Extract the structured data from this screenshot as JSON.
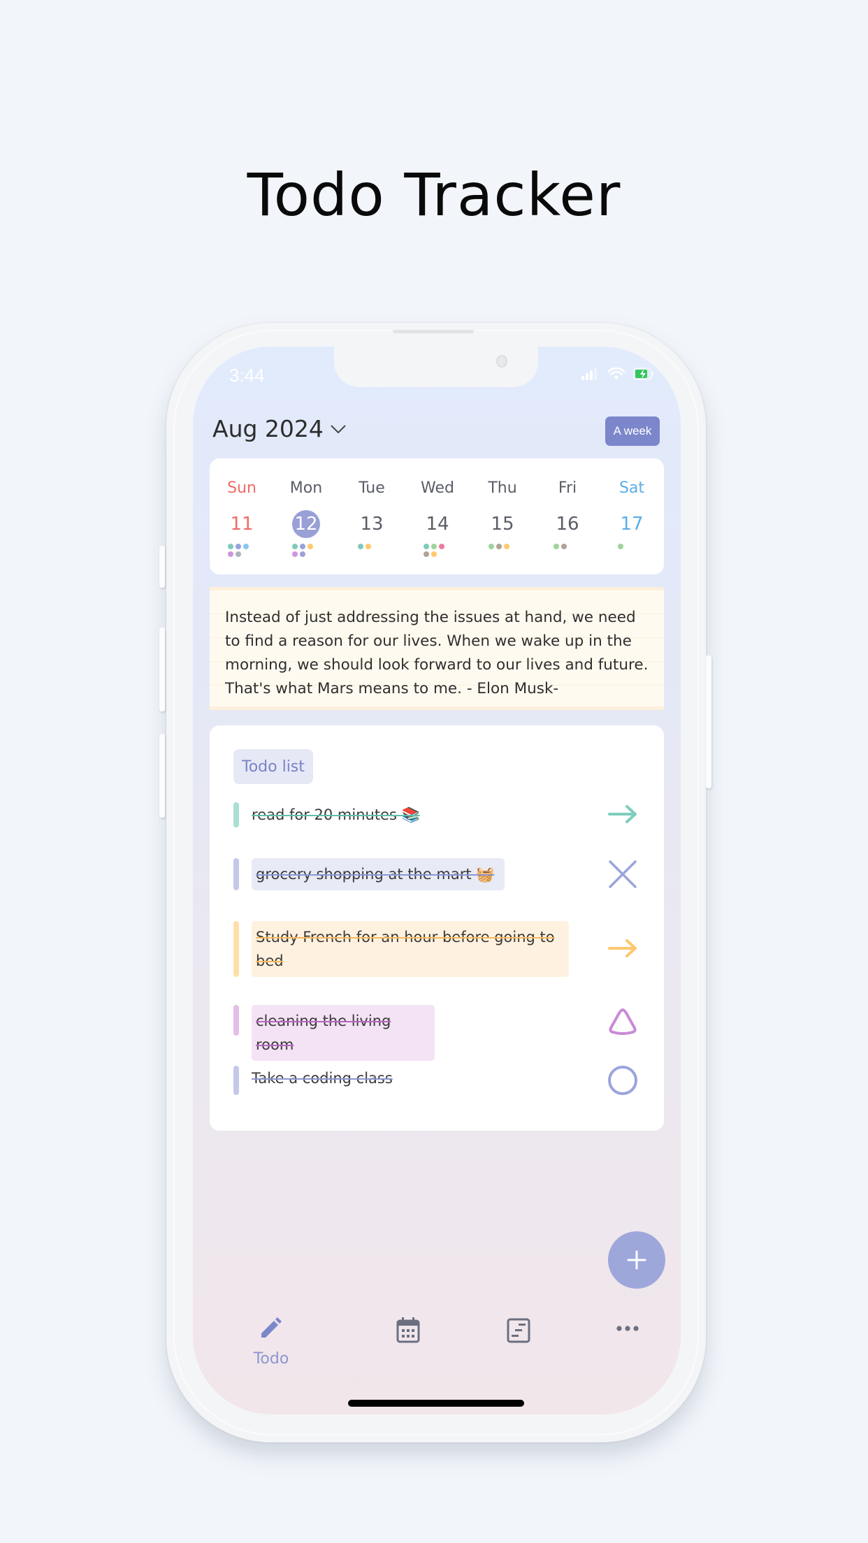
{
  "page_title": "Todo Tracker",
  "status_bar": {
    "time": "3:44",
    "icons": [
      "cellular-signal-icon",
      "wifi-icon",
      "battery-charging-icon"
    ],
    "battery_color": "#34c759"
  },
  "header": {
    "month_label": "Aug 2024",
    "month_dropdown_icon": "chevron-down-icon",
    "view_button_label": "A week",
    "accent_color": "#7b86cb"
  },
  "week": {
    "days": [
      {
        "name": "Sun",
        "date": "11",
        "color": "#ef6b66",
        "selected": false,
        "dots": [
          "#7fcabb",
          "#9aa2dc",
          "#8ac6ef",
          "#cf95de",
          "#aab4bc"
        ]
      },
      {
        "name": "Mon",
        "date": "12",
        "color": "#5a5d66",
        "selected": true,
        "dots": [
          "#7fcabb",
          "#9aa2dc",
          "#ffc96b",
          "#cf95de",
          "#9aa2dc"
        ]
      },
      {
        "name": "Tue",
        "date": "13",
        "color": "#5a5d66",
        "selected": false,
        "dots": [
          "#7fcabb",
          "#ffc96b"
        ]
      },
      {
        "name": "Wed",
        "date": "14",
        "color": "#5a5d66",
        "selected": false,
        "dots": [
          "#7fcabb",
          "#9fd39a",
          "#ef7aa0",
          "#b3a097",
          "#ffc96b"
        ]
      },
      {
        "name": "Thu",
        "date": "15",
        "color": "#5a5d66",
        "selected": false,
        "dots": [
          "#9fd39a",
          "#b3a097",
          "#ffc96b"
        ]
      },
      {
        "name": "Fri",
        "date": "16",
        "color": "#5a5d66",
        "selected": false,
        "dots": [
          "#9fd39a",
          "#b3a097"
        ]
      },
      {
        "name": "Sat",
        "date": "17",
        "color": "#5aaee9",
        "selected": false,
        "dots": [
          "#9fd39a"
        ]
      }
    ]
  },
  "quote": {
    "text": "Instead of just addressing the issues at hand, we need to find a reason for our lives. When we wake up in the morning, we should look forward to our lives and future. That's what Mars means to me. - Elon Musk-"
  },
  "todo": {
    "section_label": "Todo list",
    "items": [
      {
        "text": "read for 20 minutes 📚",
        "bar_color": "#a9e0d6",
        "highlight": "",
        "strike_color": "#5fbfae",
        "status_icon": "arrow-right-icon",
        "icon_color": "#7fcdbd",
        "completed": true
      },
      {
        "text": "grocery shopping at the mart 🧺",
        "bar_color": "#c4c9e9",
        "highlight": "#e8eaf6",
        "strike_color": "#8d96d2",
        "status_icon": "x-icon",
        "icon_color": "#9ca4dc",
        "completed": true
      },
      {
        "text": "Study French for an hour before going to bed",
        "bar_color": "#ffdfa9",
        "highlight": "#fff1df",
        "strike_color": "#f7b95c",
        "status_icon": "arrow-right-icon",
        "icon_color": "#ffc770",
        "completed": true
      },
      {
        "text": "cleaning the living room",
        "bar_color": "#e3bfe8",
        "highlight": "#f4e3f4",
        "strike_color": "#b568c2",
        "status_icon": "triangle-icon",
        "icon_color": "#c98ad6",
        "completed": true
      },
      {
        "text": "Take a coding class",
        "bar_color": "#c4c9e9",
        "highlight": "",
        "strike_color": "#8d96d2",
        "status_icon": "circle-icon",
        "icon_color": "#9ca4dc",
        "completed": true
      }
    ]
  },
  "fab": {
    "icon": "plus-icon",
    "color": "#9ea7da"
  },
  "tabbar": {
    "tabs": [
      {
        "label": "Todo",
        "icon": "pencil-icon",
        "active": true
      },
      {
        "label": "",
        "icon": "calendar-icon",
        "active": false
      },
      {
        "label": "",
        "icon": "notes-icon",
        "active": false
      },
      {
        "label": "",
        "icon": "more-icon",
        "active": false
      }
    ],
    "active_color": "#7b86cb",
    "inactive_color": "#6b6f80"
  }
}
